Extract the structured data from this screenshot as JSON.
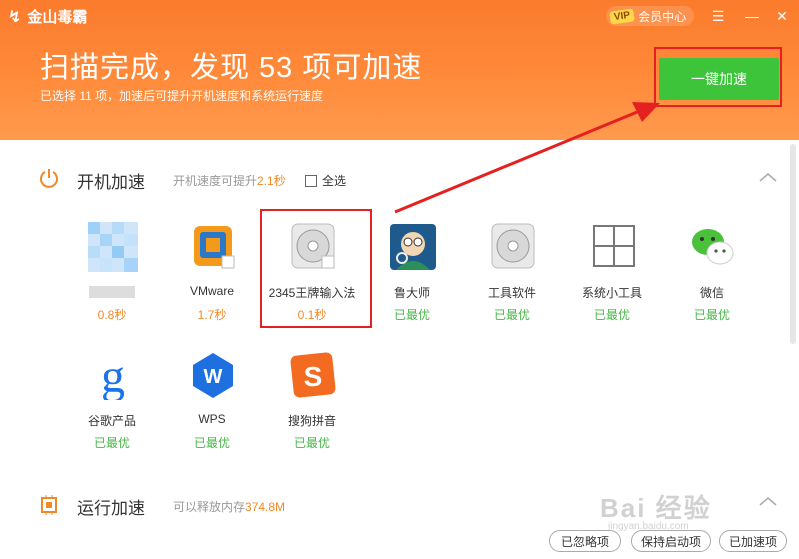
{
  "app": {
    "title": "金山毒霸",
    "vip_label": "会员中心",
    "vip_badge": "VIP",
    "menu_icon": "menu-icon",
    "minimize_icon": "minimize-icon",
    "close_icon": "close-icon"
  },
  "header": {
    "headline": "扫描完成，发现 53 项可加速",
    "subline": "已选择 11 项，加速后可提升开机速度和系统运行速度",
    "boost_button": "一键加速"
  },
  "startup": {
    "title": "开机加速",
    "hint_prefix": "开机速度可提升",
    "hint_value": "2.1秒",
    "select_all": "全选",
    "items": [
      {
        "name": "",
        "status": "0.8秒",
        "icon": "blurred-icon"
      },
      {
        "name": "VMware",
        "status": "1.7秒",
        "icon": "vmware-icon"
      },
      {
        "name": "2345王牌输入法",
        "status": "0.1秒",
        "icon": "disc-icon"
      },
      {
        "name": "鲁大师",
        "status": "已最优",
        "icon": "ludashi-icon"
      },
      {
        "name": "工具软件",
        "status": "已最优",
        "icon": "disc-icon"
      },
      {
        "name": "系统小工具",
        "status": "已最优",
        "icon": "windows-icon"
      },
      {
        "name": "微信",
        "status": "已最优",
        "icon": "wechat-icon"
      },
      {
        "name": "谷歌产品",
        "status": "已最优",
        "icon": "google-icon"
      },
      {
        "name": "WPS",
        "status": "已最优",
        "icon": "wps-icon"
      },
      {
        "name": "搜狗拼音",
        "status": "已最优",
        "icon": "sogou-icon"
      }
    ]
  },
  "runtime": {
    "title": "运行加速",
    "hint_prefix": "可以释放内存",
    "hint_value": "374.8M"
  },
  "footer": {
    "ignored": "已忽略项",
    "kept": "保持启动项",
    "boosted": "已加速项"
  },
  "watermark": {
    "text": "Bai 经验",
    "url": "jingyan.baidu.com"
  },
  "colors": {
    "header": "#fb7b2c",
    "accent": "#f08a28",
    "green": "#3dc43b",
    "annotation": "#e52020"
  }
}
